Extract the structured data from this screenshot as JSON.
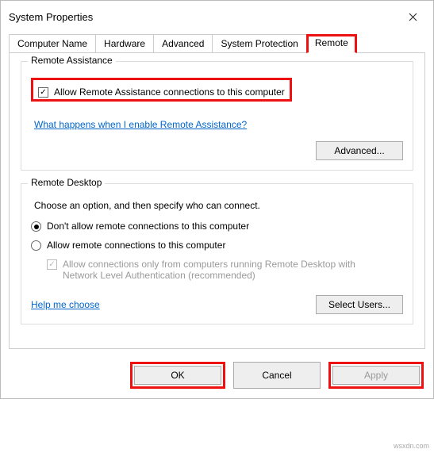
{
  "window": {
    "title": "System Properties"
  },
  "tabs": {
    "items": [
      {
        "label": "Computer Name"
      },
      {
        "label": "Hardware"
      },
      {
        "label": "Advanced"
      },
      {
        "label": "System Protection"
      },
      {
        "label": "Remote"
      }
    ],
    "active_index": 4
  },
  "remote_assistance": {
    "group_title": "Remote Assistance",
    "allow_checkbox_label": "Allow Remote Assistance connections to this computer",
    "allow_checked": true,
    "help_link": "What happens when I enable Remote Assistance?",
    "advanced_button": "Advanced..."
  },
  "remote_desktop": {
    "group_title": "Remote Desktop",
    "description": "Choose an option, and then specify who can connect.",
    "radio_dont_allow": "Don't allow remote connections to this computer",
    "radio_allow": "Allow remote connections to this computer",
    "selected_radio": "dont_allow",
    "nla_checkbox_label": "Allow connections only from computers running Remote Desktop with Network Level Authentication (recommended)",
    "nla_checked": true,
    "nla_enabled": false,
    "help_link": "Help me choose",
    "select_users_button": "Select Users..."
  },
  "dialog_buttons": {
    "ok": "OK",
    "cancel": "Cancel",
    "apply": "Apply",
    "apply_enabled": false
  },
  "watermark": "wsxdn.com"
}
